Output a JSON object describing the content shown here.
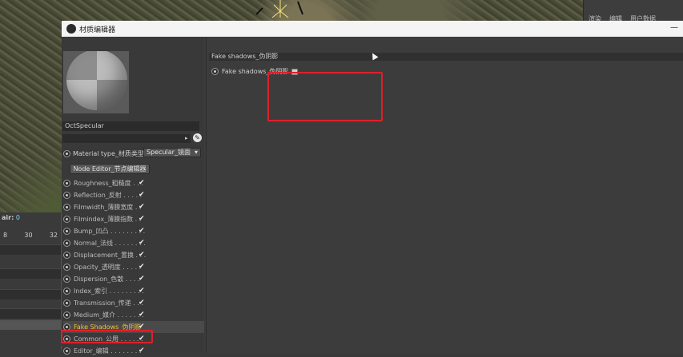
{
  "app": {
    "top_tabs": [
      "渲染",
      "编辑",
      "用户数据"
    ]
  },
  "timeline": {
    "fps_label": "air:",
    "fps_value": "0",
    "ticks": [
      "8",
      "30",
      "32"
    ]
  },
  "dialog": {
    "title": "材质编辑器",
    "minimize": "—",
    "material_name": "OctSpecular",
    "material_type_label": "Material type_材质类型",
    "material_type_value": "Specular_镜面",
    "node_editor_label": "Node Editor_节点编辑器",
    "channels": [
      {
        "label": "Roughness_粗糙度 . . .",
        "checked": true
      },
      {
        "label": "Reflection_反射 . . . . .",
        "checked": true
      },
      {
        "label": "Filmwidth_薄膜宽度 . .",
        "checked": true
      },
      {
        "label": "Filmindex_薄膜指数 . .",
        "checked": true
      },
      {
        "label": "Bump_凹凸 . . . . . . . . .",
        "checked": true
      },
      {
        "label": "Normal_法线 . . . . . . . .",
        "checked": true
      },
      {
        "label": "Displacement_置换 . . .",
        "checked": true
      },
      {
        "label": "Opacity_透明度 . . . . .",
        "checked": true
      },
      {
        "label": "Dispersion_色散 . . . .",
        "checked": true
      },
      {
        "label": "Index_索引 . . . . . . . . .",
        "checked": true
      },
      {
        "label": "Transmission_传递 . . .",
        "checked": true
      },
      {
        "label": "Medium_媒介 . . . . . . .",
        "checked": true
      },
      {
        "label": "Fake Shadows_伪阴影",
        "checked": true,
        "selected": true
      },
      {
        "label": "Common_公用 . . . . . .",
        "checked": true
      },
      {
        "label": "Editor_编辑 . . . . . . . .",
        "checked": true
      }
    ],
    "section_header": "Fake shadows_伪阴影",
    "fake_shadows_param": "Fake shadows_伪阴影",
    "check_mark": "✔"
  },
  "colors": {
    "highlight": "#e0202a",
    "selected_text": "#f2c12e"
  }
}
